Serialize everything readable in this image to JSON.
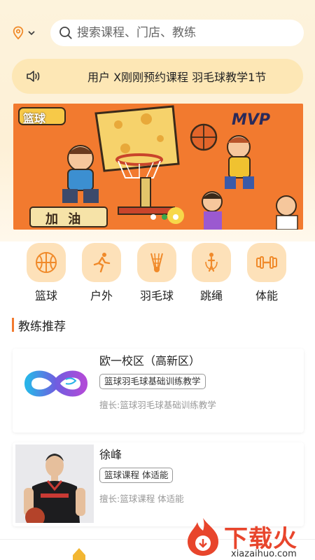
{
  "search": {
    "placeholder": "搜索课程、门店、教练"
  },
  "notice": {
    "text": "用户 X刚刚预约课程 羽毛球教学1节"
  },
  "banner": {
    "badge_text": "篮球",
    "mvp_text": "MVP",
    "cheer_text": "加 油",
    "active_dot": 1
  },
  "categories": [
    {
      "label": "篮球",
      "icon": "basketball-icon"
    },
    {
      "label": "户外",
      "icon": "runner-icon"
    },
    {
      "label": "羽毛球",
      "icon": "shuttlecock-icon"
    },
    {
      "label": "跳绳",
      "icon": "jump-rope-icon"
    },
    {
      "label": "体能",
      "icon": "dumbbell-icon"
    }
  ],
  "section": {
    "title": "教练推荐"
  },
  "coaches": [
    {
      "name": "欧一校区（高新区）",
      "tag": "篮球羽毛球基础训练教学",
      "skill": "擅长:篮球羽毛球基础训练教学",
      "image": "infinity-logo"
    },
    {
      "name": "徐峰",
      "tag": "篮球课程 体适能",
      "skill": "擅长:篮球课程 体适能",
      "image": "coach-photo"
    }
  ],
  "watermark": {
    "text": "下载火",
    "url": "xiazaihuo.com"
  },
  "colors": {
    "accent": "#f27a2f",
    "notice_bg": "#fde7b5",
    "category_bg": "#fde1b9"
  }
}
